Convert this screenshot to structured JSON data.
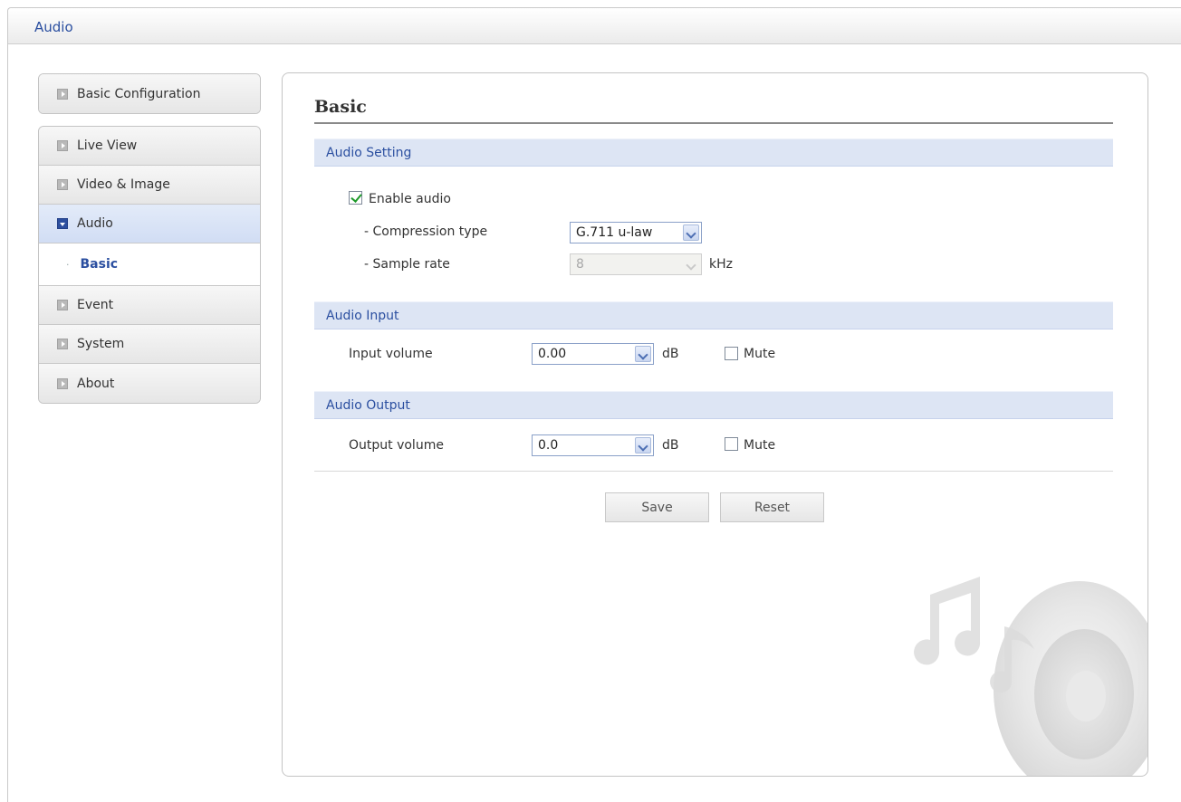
{
  "header": {
    "title": "Audio"
  },
  "sidebar": {
    "top_item": {
      "label": "Basic Configuration"
    },
    "items": [
      {
        "label": "Live View"
      },
      {
        "label": "Video & Image"
      },
      {
        "label": "Audio"
      },
      {
        "label": "Event"
      },
      {
        "label": "System"
      },
      {
        "label": "About"
      }
    ],
    "active_item": "Audio",
    "sub_item": {
      "label": "Basic",
      "bullet": "·"
    }
  },
  "main": {
    "title": "Basic",
    "audio_setting": {
      "section_label": "Audio Setting",
      "enable_audio_label": "Enable audio",
      "enable_audio_checked": true,
      "compression_label": "- Compression type",
      "compression_value": "G.711 u-law",
      "sample_rate_label": "- Sample rate",
      "sample_rate_value": "8",
      "sample_rate_unit": "kHz"
    },
    "audio_input": {
      "section_label": "Audio Input",
      "volume_label": "Input volume",
      "volume_value": "0.00",
      "unit": "dB",
      "mute_label": "Mute",
      "mute_checked": false
    },
    "audio_output": {
      "section_label": "Audio Output",
      "volume_label": "Output volume",
      "volume_value": "0.0",
      "unit": "dB",
      "mute_label": "Mute",
      "mute_checked": false
    },
    "buttons": {
      "save": "Save",
      "reset": "Reset"
    }
  },
  "colors": {
    "accent": "#2b4fa0",
    "section_bar": "#dde5f4",
    "check_mark": "#1e9a2a"
  }
}
